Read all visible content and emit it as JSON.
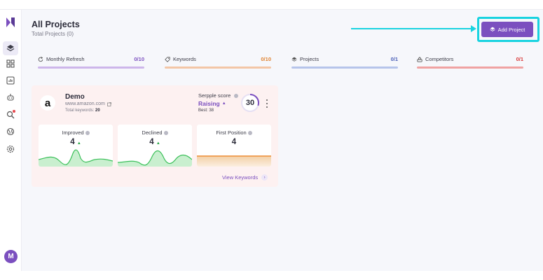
{
  "header": {
    "title": "All Projects",
    "subtitle": "Total Projects (0)",
    "add_button_label": "Add Project"
  },
  "sidebar": {
    "logo": "serpple-logo",
    "items": [
      {
        "icon": "layers-icon",
        "active": true
      },
      {
        "icon": "grid-icon"
      },
      {
        "icon": "chart-icon"
      },
      {
        "icon": "bot-icon"
      },
      {
        "icon": "search-icon",
        "badge": true
      },
      {
        "icon": "globe-icon"
      },
      {
        "icon": "gear-icon"
      }
    ],
    "avatar_initial": "M"
  },
  "stats": [
    {
      "label": "Monthly Refresh",
      "value": "0/10",
      "icon": "refresh-icon",
      "bar_color": "#cdb6ea",
      "value_color": "#7b4fbf"
    },
    {
      "label": "Keywords",
      "value": "0/10",
      "icon": "tag-icon",
      "bar_color": "#f3c6a6",
      "value_color": "#e0822f"
    },
    {
      "label": "Projects",
      "value": "0/1",
      "icon": "layers-icon",
      "bar_color": "#b6c4ea",
      "value_color": "#4a5fb8"
    },
    {
      "label": "Competitors",
      "value": "0/1",
      "icon": "competitor-icon",
      "bar_color": "#f0a2a2",
      "value_color": "#d83a3a"
    }
  ],
  "project": {
    "name": "Demo",
    "url": "www.amazon.com",
    "total_keywords_label": "Total keywords:",
    "total_keywords": "20",
    "serp_label": "Serpple score",
    "serp_status": "Raising",
    "best_label": "Best: 38",
    "score": "30",
    "score_fraction": 0.3,
    "metrics": [
      {
        "label": "Improved",
        "value": "4"
      },
      {
        "label": "Declined",
        "value": "4"
      },
      {
        "label": "First Position",
        "value": "4"
      }
    ],
    "view_keywords": "View Keywords"
  },
  "colors": {
    "accent": "#7b4fbf",
    "highlight": "#19d3e0"
  }
}
